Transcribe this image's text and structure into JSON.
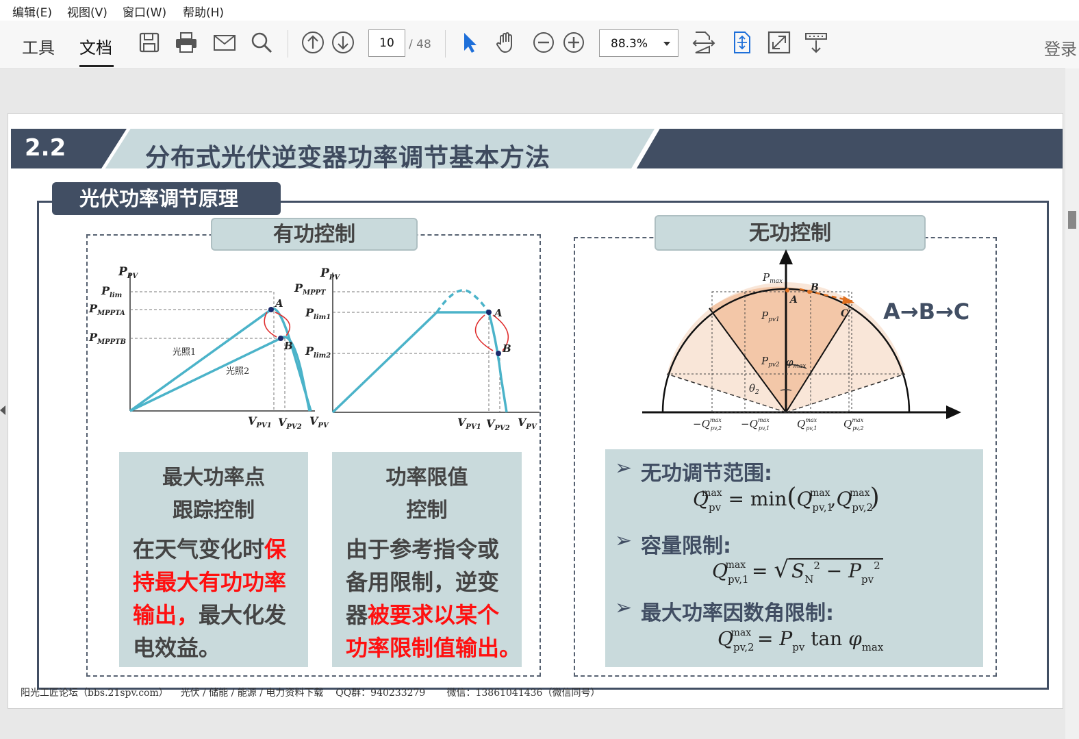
{
  "menu": [
    "编辑(E)",
    "视图(V)",
    "窗口(W)",
    "帮助(H)"
  ],
  "toolbar": {
    "tab_tools": "工具",
    "tab_document": "文档",
    "page_current": "10",
    "page_total": "/ 48",
    "zoom": "88.3%",
    "login": "登录"
  },
  "slide": {
    "section_number": "2.2",
    "section_title": "分布式光伏逆变器功率调节基本方法",
    "subtitle": "光伏功率调节原理",
    "active_panel": {
      "title": "有功控制",
      "chart1": {
        "y_label": "P",
        "y_sub": "PV",
        "p_lim": "lim",
        "p_mppta": "MPPTA",
        "p_mpptb": "MPPTB",
        "curve1": "光照1",
        "curve2": "光照2",
        "x1": "PV1",
        "x2": "PV2",
        "x3": "PV",
        "pt_a": "A",
        "pt_b": "B"
      },
      "chart2": {
        "y_label": "P",
        "y_sub": "PV",
        "p_mppt": "MPPT",
        "p_lim1": "lim1",
        "p_lim2": "lim2",
        "x1": "PV1",
        "x2": "PV2",
        "x3": "PV",
        "pt_a": "A",
        "pt_b": "B"
      },
      "card_left": {
        "title1": "最大功率点",
        "title2": "跟踪控制",
        "line1a": "在天气变化时",
        "line1b": "保",
        "line2": "持最大有功功率",
        "line3a": "输出，",
        "line3b": "最大化发",
        "line4": "电效益。"
      },
      "card_right": {
        "title1": "功率限值",
        "title2": "控制",
        "line1": "由于参考指令或",
        "line2": "备用限制，逆变",
        "line3a": "器",
        "line3b": "被要求以某个",
        "line4": "功率限制值输出。"
      }
    },
    "reactive_panel": {
      "title": "无功控制",
      "abc": "A→B→C",
      "diagram": {
        "pmax": "max",
        "ppv1": "pv1",
        "ppv2": "pv2",
        "phi": "φ",
        "phimax": "max",
        "theta": "θ",
        "theta_sub": "2",
        "pt_a": "A",
        "pt_b": "B",
        "pt_c": "C",
        "ticks": [
          "−Q",
          "−Q",
          "Q",
          "Q"
        ],
        "tick_subs": [
          "pv,2",
          "pv,1",
          "pv,1",
          "pv,2"
        ],
        "tick_sup": "max"
      },
      "bullets": [
        "无功调节范围:",
        "容量限制:",
        "最大功率因数角限制:"
      ],
      "formula1": {
        "lhs": "Q",
        "lhs_sub": "pv",
        "sup": "max",
        "eq": "= min",
        "a": "Q",
        "a_sub": "pv,1",
        "b": "Q",
        "b_sub": "pv,2"
      },
      "formula2": {
        "lhs": "Q",
        "lhs_sub": "pv,1",
        "sup": "max",
        "s": "S",
        "s_sub": "N",
        "p": "P",
        "p_sub": "pv",
        "sq": "2"
      },
      "formula3": {
        "lhs": "Q",
        "lhs_sub": "pv,2",
        "sup": "max",
        "p": "P",
        "p_sub": "pv",
        "tan": "tan",
        "phi": "φ",
        "phi_sub": "max"
      }
    },
    "footer": "阳光工匠论坛（bbs.21spv.com）    光伏 / 储能 / 能源 / 电力资料下载    QQ群：940233279       微信：13861041436（微信同号）"
  },
  "colors": {
    "accent_dark": "#414e63",
    "accent_light": "#c9dadc",
    "curve": "#4bb3c9",
    "highlight_red": "#ff1010",
    "fill_orange": "#f3c7a8"
  }
}
